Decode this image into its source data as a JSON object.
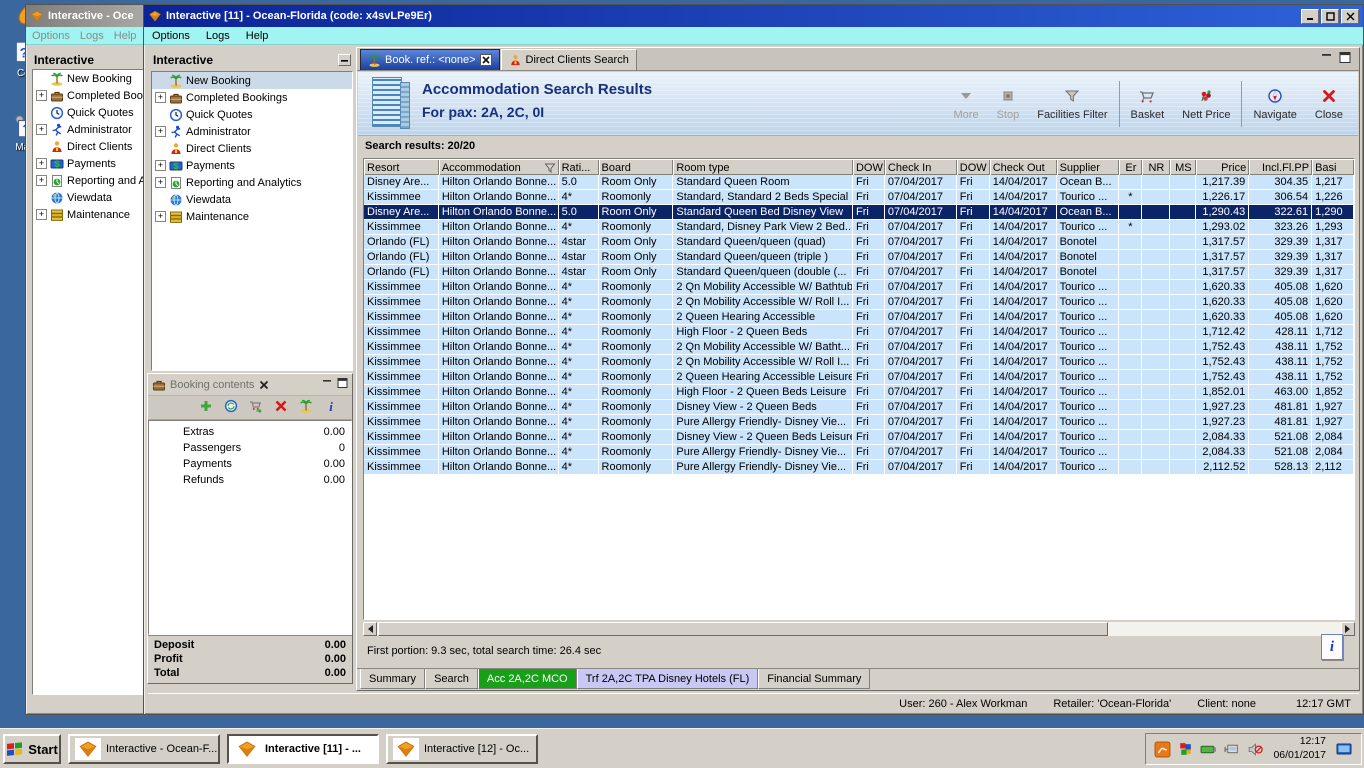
{
  "desktop": {
    "icons": [
      {
        "icon": "desk-torch",
        "label": ""
      },
      {
        "icon": "desk-doc",
        "label": "Cor"
      },
      {
        "icon": "desk-map",
        "label": "Map"
      }
    ]
  },
  "back_window": {
    "title": "Interactive - Oce",
    "menus": [
      "Options",
      "Logs",
      "Help"
    ],
    "panel_title": "Interactive"
  },
  "main_window": {
    "title": "Interactive [11] - Ocean-Florida (code: x4svLPe9Er)",
    "menus": [
      "Options",
      "Logs",
      "Help"
    ],
    "panel_title": "Interactive"
  },
  "sidebar_items": [
    {
      "label": "New Booking",
      "icon": "palm-island",
      "expandable": false,
      "selected": true
    },
    {
      "label": "Completed Bookings",
      "icon": "bookings",
      "expandable": true
    },
    {
      "label": "Quick Quotes",
      "icon": "clock",
      "expandable": false
    },
    {
      "label": "Administrator",
      "icon": "runner",
      "expandable": true
    },
    {
      "label": "Direct Clients",
      "icon": "client",
      "expandable": false
    },
    {
      "label": "Payments",
      "icon": "payments",
      "expandable": true
    },
    {
      "label": "Reporting and Analytics",
      "icon": "report",
      "expandable": true
    },
    {
      "label": "Viewdata",
      "icon": "globe",
      "expandable": false
    },
    {
      "label": "Maintenance",
      "icon": "drawers",
      "expandable": true
    }
  ],
  "booking_contents": {
    "title": "Booking contents",
    "toolbar_icons": [
      "add",
      "quote",
      "cart-move",
      "delete",
      "palm-island",
      "info"
    ],
    "rows": [
      {
        "label": "Extras",
        "value": "0.00"
      },
      {
        "label": "Passengers",
        "value": "0"
      },
      {
        "label": "Payments",
        "value": "0.00"
      },
      {
        "label": "Refunds",
        "value": "0.00"
      }
    ],
    "totals": [
      {
        "label": "Deposit",
        "value": "0.00"
      },
      {
        "label": "Profit",
        "value": "0.00"
      },
      {
        "label": "Total",
        "value": "0.00"
      }
    ]
  },
  "results": {
    "tabs": [
      {
        "label": "Book. ref.: <none>",
        "icon": "palm-island",
        "active": true,
        "closable": true
      },
      {
        "label": "Direct Clients Search",
        "icon": "client",
        "active": false,
        "closable": false
      }
    ],
    "title": "Accommodation Search Results",
    "subtitle": "For pax: 2A, 2C, 0I",
    "toolbar": [
      {
        "label": "More",
        "icon": "more",
        "disabled": true,
        "group": 1
      },
      {
        "label": "Stop",
        "icon": "stop",
        "disabled": true,
        "group": 1
      },
      {
        "label": "Facilities Filter",
        "icon": "filter",
        "disabled": false,
        "group": 1
      },
      {
        "label": "Basket",
        "icon": "basket",
        "disabled": false,
        "group": 2
      },
      {
        "label": "Nett Price",
        "icon": "nett",
        "disabled": false,
        "group": 2
      },
      {
        "label": "Navigate",
        "icon": "navigate",
        "disabled": false,
        "group": 3
      },
      {
        "label": "Close",
        "icon": "close",
        "disabled": false,
        "group": 3
      }
    ],
    "results_label": "Search results: 20/20",
    "timing": "First portion: 9.3 sec, total search time: 26.4 sec",
    "info_glyph": "i",
    "bottom_tabs": [
      {
        "label": "Summary",
        "style": "plain"
      },
      {
        "label": "Search",
        "style": "plain"
      },
      {
        "label": "Acc 2A,2C MCO",
        "style": "green"
      },
      {
        "label": "Trf 2A,2C TPA Disney Hotels (FL)",
        "style": "lavender"
      },
      {
        "label": "Financial Summary",
        "style": "plain"
      }
    ]
  },
  "table": {
    "columns": [
      "Resort",
      "Accommodation",
      "Rati...",
      "Board",
      "Room type",
      "DOW",
      "Check In",
      "DOW",
      "Check Out",
      "Supplier",
      "Er",
      "NR",
      "MS",
      "Price",
      "Incl.Fl.PP",
      "Basi"
    ],
    "selected_row": 2,
    "rows": [
      [
        "Disney Are...",
        "Hilton Orlando Bonne...",
        "5.0",
        "Room Only",
        "Standard Queen Room",
        "Fri",
        "07/04/2017",
        "Fri",
        "14/04/2017",
        "Ocean B...",
        "",
        "",
        "",
        "1,217.39",
        "304.35",
        "1,217"
      ],
      [
        "Kissimmee",
        "Hilton Orlando Bonne...",
        "4*",
        "Roomonly",
        "Standard, Standard 2 Beds Special",
        "Fri",
        "07/04/2017",
        "Fri",
        "14/04/2017",
        "Tourico ...",
        "*",
        "",
        "",
        "1,226.17",
        "306.54",
        "1,226"
      ],
      [
        "Disney Are...",
        "Hilton Orlando Bonne...",
        "5.0",
        "Room Only",
        "Standard Queen Bed Disney View",
        "Fri",
        "07/04/2017",
        "Fri",
        "14/04/2017",
        "Ocean B...",
        "",
        "",
        "",
        "1,290.43",
        "322.61",
        "1,290"
      ],
      [
        "Kissimmee",
        "Hilton Orlando Bonne...",
        "4*",
        "Roomonly",
        "Standard, Disney Park View 2 Bed...",
        "Fri",
        "07/04/2017",
        "Fri",
        "14/04/2017",
        "Tourico ...",
        "*",
        "",
        "",
        "1,293.02",
        "323.26",
        "1,293"
      ],
      [
        "Orlando (FL)",
        "Hilton Orlando Bonne...",
        "4star",
        "Room Only",
        "Standard Queen/queen (quad)",
        "Fri",
        "07/04/2017",
        "Fri",
        "14/04/2017",
        "Bonotel",
        "",
        "",
        "",
        "1,317.57",
        "329.39",
        "1,317"
      ],
      [
        "Orlando (FL)",
        "Hilton Orlando Bonne...",
        "4star",
        "Room Only",
        "Standard Queen/queen (triple )",
        "Fri",
        "07/04/2017",
        "Fri",
        "14/04/2017",
        "Bonotel",
        "",
        "",
        "",
        "1,317.57",
        "329.39",
        "1,317"
      ],
      [
        "Orlando (FL)",
        "Hilton Orlando Bonne...",
        "4star",
        "Room Only",
        "Standard Queen/queen (double (...",
        "Fri",
        "07/04/2017",
        "Fri",
        "14/04/2017",
        "Bonotel",
        "",
        "",
        "",
        "1,317.57",
        "329.39",
        "1,317"
      ],
      [
        "Kissimmee",
        "Hilton Orlando Bonne...",
        "4*",
        "Roomonly",
        "2 Qn Mobility Accessible W/ Bathtub",
        "Fri",
        "07/04/2017",
        "Fri",
        "14/04/2017",
        "Tourico ...",
        "",
        "",
        "",
        "1,620.33",
        "405.08",
        "1,620"
      ],
      [
        "Kissimmee",
        "Hilton Orlando Bonne...",
        "4*",
        "Roomonly",
        "2 Qn Mobility Accessible W/ Roll I...",
        "Fri",
        "07/04/2017",
        "Fri",
        "14/04/2017",
        "Tourico ...",
        "",
        "",
        "",
        "1,620.33",
        "405.08",
        "1,620"
      ],
      [
        "Kissimmee",
        "Hilton Orlando Bonne...",
        "4*",
        "Roomonly",
        "2 Queen Hearing Accessible",
        "Fri",
        "07/04/2017",
        "Fri",
        "14/04/2017",
        "Tourico ...",
        "",
        "",
        "",
        "1,620.33",
        "405.08",
        "1,620"
      ],
      [
        "Kissimmee",
        "Hilton Orlando Bonne...",
        "4*",
        "Roomonly",
        "High Floor - 2 Queen Beds",
        "Fri",
        "07/04/2017",
        "Fri",
        "14/04/2017",
        "Tourico ...",
        "",
        "",
        "",
        "1,712.42",
        "428.11",
        "1,712"
      ],
      [
        "Kissimmee",
        "Hilton Orlando Bonne...",
        "4*",
        "Roomonly",
        "2 Qn Mobility Accessible W/ Batht...",
        "Fri",
        "07/04/2017",
        "Fri",
        "14/04/2017",
        "Tourico ...",
        "",
        "",
        "",
        "1,752.43",
        "438.11",
        "1,752"
      ],
      [
        "Kissimmee",
        "Hilton Orlando Bonne...",
        "4*",
        "Roomonly",
        "2 Qn Mobility Accessible W/ Roll I...",
        "Fri",
        "07/04/2017",
        "Fri",
        "14/04/2017",
        "Tourico ...",
        "",
        "",
        "",
        "1,752.43",
        "438.11",
        "1,752"
      ],
      [
        "Kissimmee",
        "Hilton Orlando Bonne...",
        "4*",
        "Roomonly",
        "2 Queen Hearing Accessible Leisure",
        "Fri",
        "07/04/2017",
        "Fri",
        "14/04/2017",
        "Tourico ...",
        "",
        "",
        "",
        "1,752.43",
        "438.11",
        "1,752"
      ],
      [
        "Kissimmee",
        "Hilton Orlando Bonne...",
        "4*",
        "Roomonly",
        "High Floor - 2 Queen Beds Leisure",
        "Fri",
        "07/04/2017",
        "Fri",
        "14/04/2017",
        "Tourico ...",
        "",
        "",
        "",
        "1,852.01",
        "463.00",
        "1,852"
      ],
      [
        "Kissimmee",
        "Hilton Orlando Bonne...",
        "4*",
        "Roomonly",
        "Disney View - 2 Queen Beds",
        "Fri",
        "07/04/2017",
        "Fri",
        "14/04/2017",
        "Tourico ...",
        "",
        "",
        "",
        "1,927.23",
        "481.81",
        "1,927"
      ],
      [
        "Kissimmee",
        "Hilton Orlando Bonne...",
        "4*",
        "Roomonly",
        "Pure Allergy Friendly- Disney Vie...",
        "Fri",
        "07/04/2017",
        "Fri",
        "14/04/2017",
        "Tourico ...",
        "",
        "",
        "",
        "1,927.23",
        "481.81",
        "1,927"
      ],
      [
        "Kissimmee",
        "Hilton Orlando Bonne...",
        "4*",
        "Roomonly",
        "Disney View - 2 Queen Beds Leisure",
        "Fri",
        "07/04/2017",
        "Fri",
        "14/04/2017",
        "Tourico ...",
        "",
        "",
        "",
        "2,084.33",
        "521.08",
        "2,084"
      ],
      [
        "Kissimmee",
        "Hilton Orlando Bonne...",
        "4*",
        "Roomonly",
        "Pure Allergy Friendly- Disney Vie...",
        "Fri",
        "07/04/2017",
        "Fri",
        "14/04/2017",
        "Tourico ...",
        "",
        "",
        "",
        "2,084.33",
        "521.08",
        "2,084"
      ],
      [
        "Kissimmee",
        "Hilton Orlando Bonne...",
        "4*",
        "Roomonly",
        "Pure Allergy Friendly- Disney Vie...",
        "Fri",
        "07/04/2017",
        "Fri",
        "14/04/2017",
        "Tourico ...",
        "",
        "",
        "",
        "2,112.52",
        "528.13",
        "2,112"
      ]
    ]
  },
  "statusbar": {
    "user": "User: 260 - Alex Workman",
    "retailer": "Retailer: 'Ocean-Florida'",
    "client": "Client: none",
    "time": "12:17 GMT"
  },
  "taskbar": {
    "start_label": "Start",
    "buttons": [
      {
        "label": "Interactive - Ocean-F...",
        "active": false
      },
      {
        "label": "Interactive [11] - ...",
        "active": true
      },
      {
        "label": "Interactive [12] - Oc...",
        "active": false
      }
    ],
    "tray": {
      "icons": [
        "tray-launcher",
        "tray-shield",
        "tray-card",
        "tray-network",
        "tray-muted"
      ],
      "time": "12:17",
      "date": "06/01/2017",
      "desktop_icon": "tray-desktop"
    }
  },
  "colors": {
    "selection": "#0b2468",
    "row_blue": "#c9e4fb",
    "tab_green": "#18a018",
    "tab_lavender": "#c8c8f4"
  }
}
